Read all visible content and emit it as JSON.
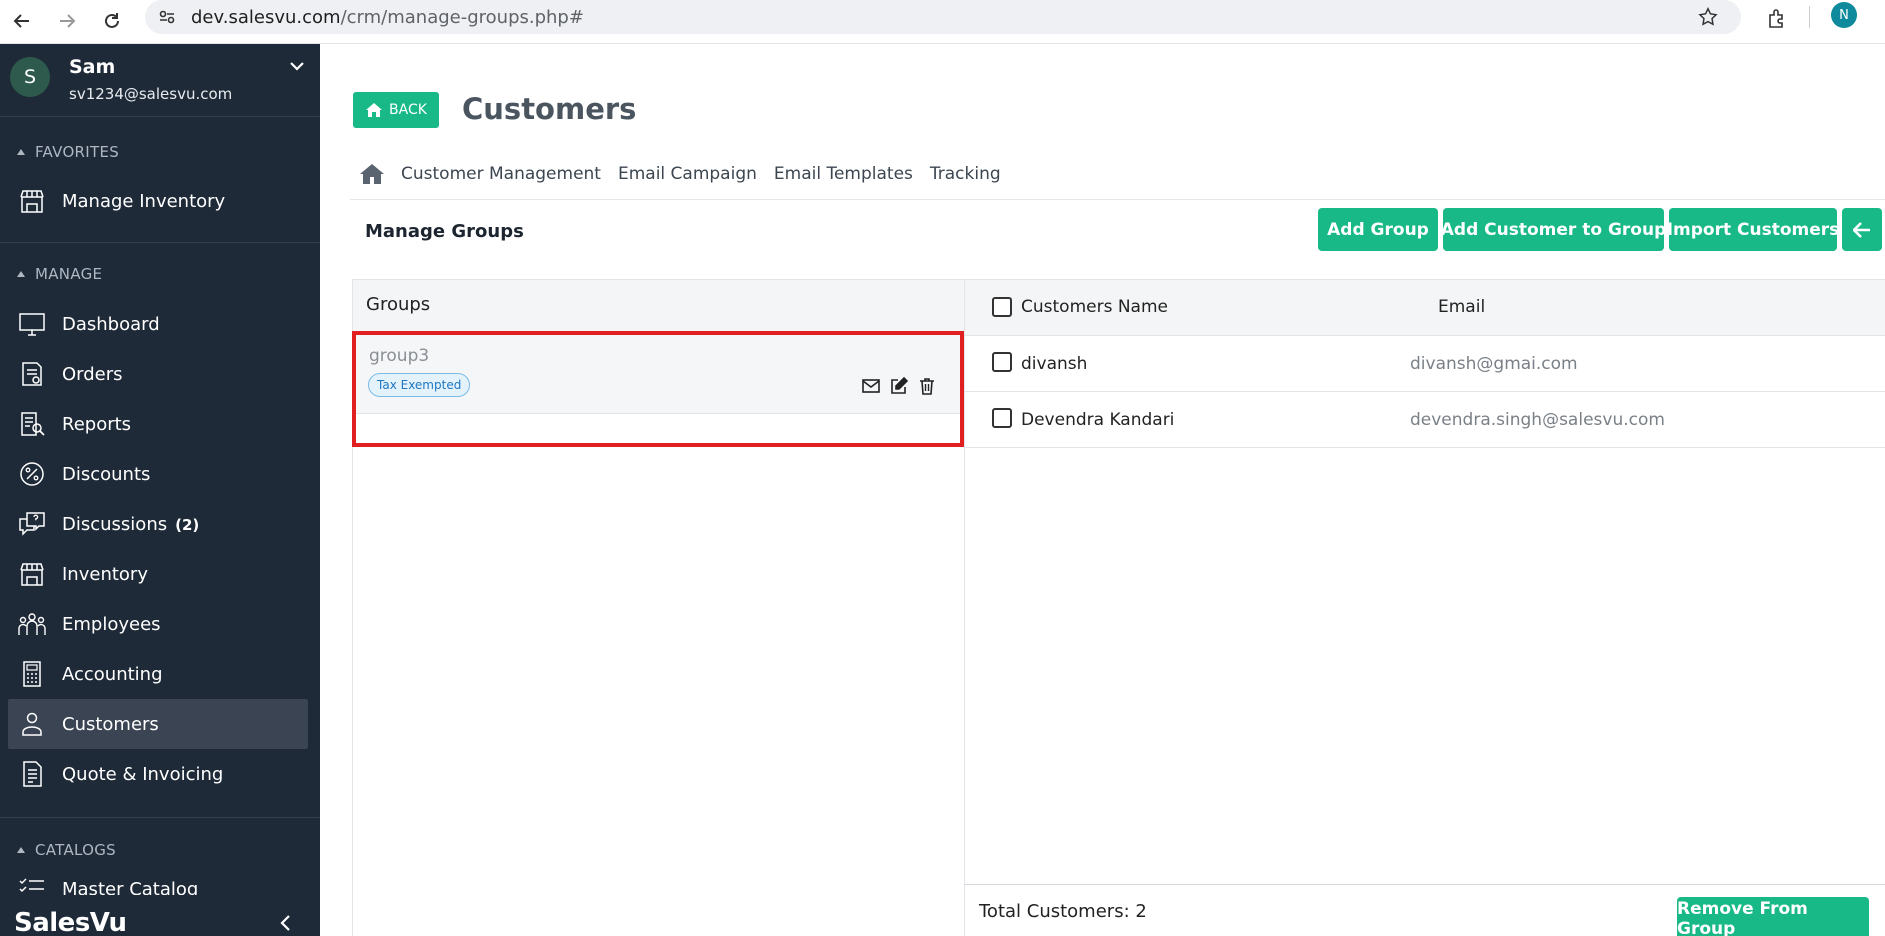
{
  "browser": {
    "url_host": "dev.salesvu.com",
    "url_path": "/crm/manage-groups.php#",
    "profile_initial": "N"
  },
  "sidebar": {
    "user": {
      "initial": "S",
      "name": "Sam",
      "email": "sv1234@salesvu.com"
    },
    "sections": {
      "favorites": "FAVORITES",
      "manage": "MANAGE",
      "catalogs": "CATALOGS"
    },
    "favorites": [
      {
        "label": "Manage Inventory",
        "icon": "store-icon"
      }
    ],
    "items": [
      {
        "label": "Dashboard",
        "icon": "monitor-icon"
      },
      {
        "label": "Orders",
        "icon": "orders-icon"
      },
      {
        "label": "Reports",
        "icon": "reports-icon"
      },
      {
        "label": "Discounts",
        "icon": "percent-icon"
      },
      {
        "label": "Discussions",
        "icon": "chat-icon",
        "badge": "(2)"
      },
      {
        "label": "Inventory",
        "icon": "store-icon"
      },
      {
        "label": "Employees",
        "icon": "employees-icon"
      },
      {
        "label": "Accounting",
        "icon": "calculator-icon"
      },
      {
        "label": "Customers",
        "icon": "customer-icon",
        "active": true
      },
      {
        "label": "Quote & Invoicing",
        "icon": "invoice-icon"
      }
    ],
    "catalog_partial": "Master Catalog",
    "brand": "SalesVu"
  },
  "header": {
    "back_label": "BACK",
    "title": "Customers"
  },
  "subnav": [
    "Customer Management",
    "Email Campaign",
    "Email Templates",
    "Tracking"
  ],
  "toolbar": {
    "section_title": "Manage Groups",
    "add_group": "Add Group",
    "add_customer_to_group": "Add Customer to Group",
    "import_customers": "Import Customers"
  },
  "groups": {
    "header": "Groups",
    "rows": [
      {
        "name": "group3",
        "tag": "Tax Exempted"
      }
    ]
  },
  "customers": {
    "col_name": "Customers Name",
    "col_email": "Email",
    "rows": [
      {
        "name": "divansh",
        "email": "divansh@gmai.com"
      },
      {
        "name": "Devendra Kandari",
        "email": "devendra.singh@salesvu.com"
      }
    ],
    "total": "Total Customers: 2",
    "remove_label": "Remove From Group"
  },
  "colors": {
    "accent": "#18b987",
    "sidebar_bg": "#1f2a38",
    "highlight": "#e02020"
  }
}
